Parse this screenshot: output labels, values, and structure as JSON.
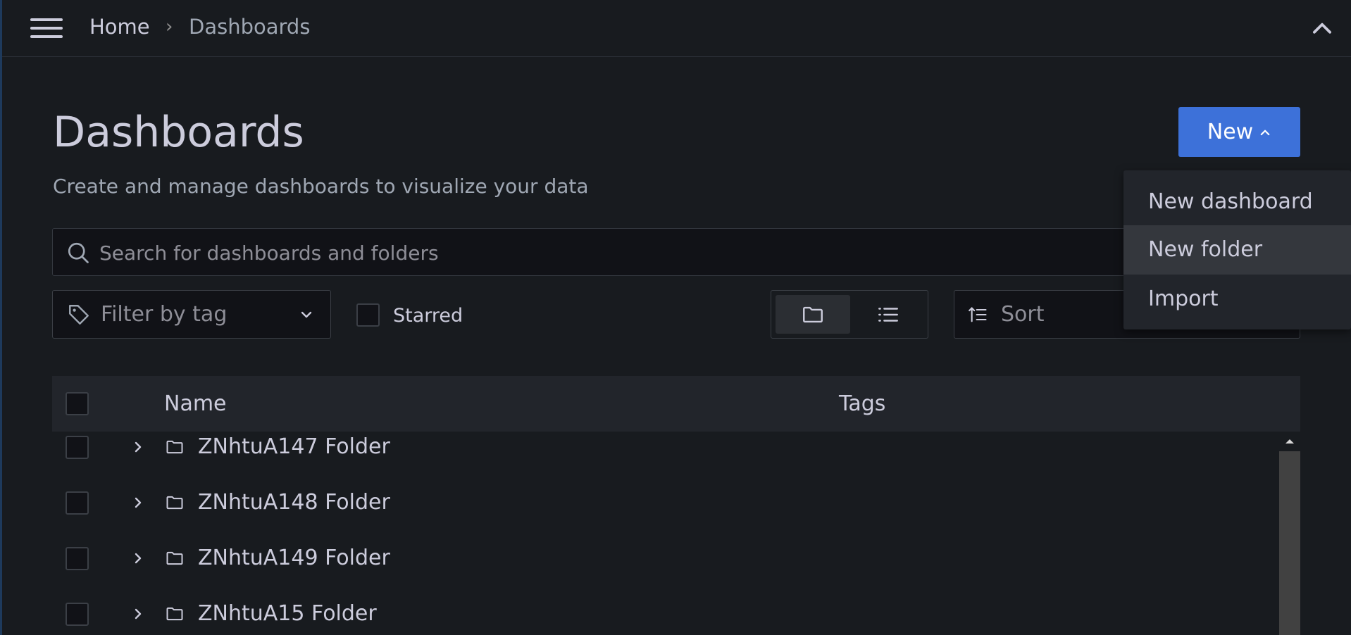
{
  "breadcrumb": {
    "home": "Home",
    "separator": "›",
    "current": "Dashboards"
  },
  "page": {
    "title": "Dashboards",
    "subtitle": "Create and manage dashboards to visualize your data"
  },
  "new_button": {
    "label": "New"
  },
  "new_menu": {
    "items": [
      {
        "label": "New dashboard",
        "highlighted": false
      },
      {
        "label": "New folder",
        "highlighted": true
      },
      {
        "label": "Import",
        "highlighted": false
      }
    ]
  },
  "search": {
    "placeholder": "Search for dashboards and folders",
    "value": ""
  },
  "filters": {
    "tag_placeholder": "Filter by tag",
    "starred_label": "Starred",
    "starred_checked": false,
    "view_mode": "folder",
    "sort_placeholder": "Sort"
  },
  "table": {
    "columns": [
      "Name",
      "Tags"
    ],
    "rows": [
      {
        "name": "ZNhtuA147 Folder",
        "tags": []
      },
      {
        "name": "ZNhtuA148 Folder",
        "tags": []
      },
      {
        "name": "ZNhtuA149 Folder",
        "tags": []
      },
      {
        "name": "ZNhtuA15 Folder",
        "tags": []
      }
    ]
  },
  "icons": {
    "menu": "hamburger-icon",
    "collapse": "chevron-up-icon",
    "search": "search-icon",
    "tag": "tag-icon",
    "dropdown": "chevron-down-icon",
    "folder_view": "folder-icon",
    "list_view": "list-icon",
    "sort": "sort-ascending-icon",
    "row_expand": "chevron-right-icon",
    "row_folder": "folder-icon"
  },
  "colors": {
    "background": "#181b1f",
    "primary": "#3d71d9",
    "text": "#ccccdc",
    "text_secondary": "#9fa7b3"
  }
}
